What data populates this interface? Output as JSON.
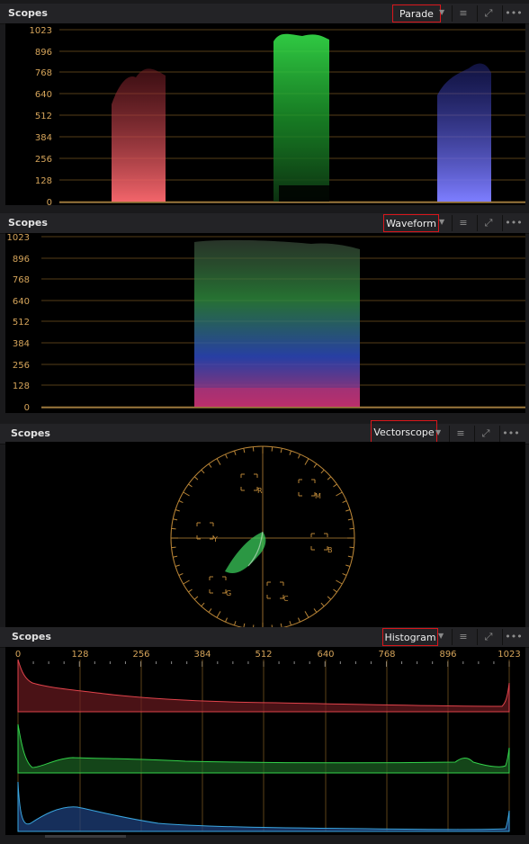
{
  "panels": [
    {
      "title": "Scopes",
      "mode": "Parade"
    },
    {
      "title": "Scopes",
      "mode": "Waveform"
    },
    {
      "title": "Scopes",
      "mode": "Vectorscope"
    },
    {
      "title": "Scopes",
      "mode": "Histogram"
    }
  ],
  "icons": {
    "settings": "sliders-icon",
    "expand": "expand-icon",
    "more": "more-icon",
    "dropdown": "chevron-down-icon"
  },
  "waveform_scale": [
    "1023",
    "896",
    "768",
    "640",
    "512",
    "384",
    "256",
    "128",
    "0"
  ],
  "histogram_scale": [
    "0",
    "128",
    "256",
    "384",
    "512",
    "640",
    "768",
    "896",
    "1023"
  ],
  "vectorscope_targets": [
    "R",
    "M",
    "Y",
    "B",
    "G",
    "C"
  ],
  "colors": {
    "accent_red": "#d8161b",
    "graticule": "#d5a45a",
    "red": "#e0434b",
    "green": "#33d24a",
    "blue": "#3f58ff"
  }
}
